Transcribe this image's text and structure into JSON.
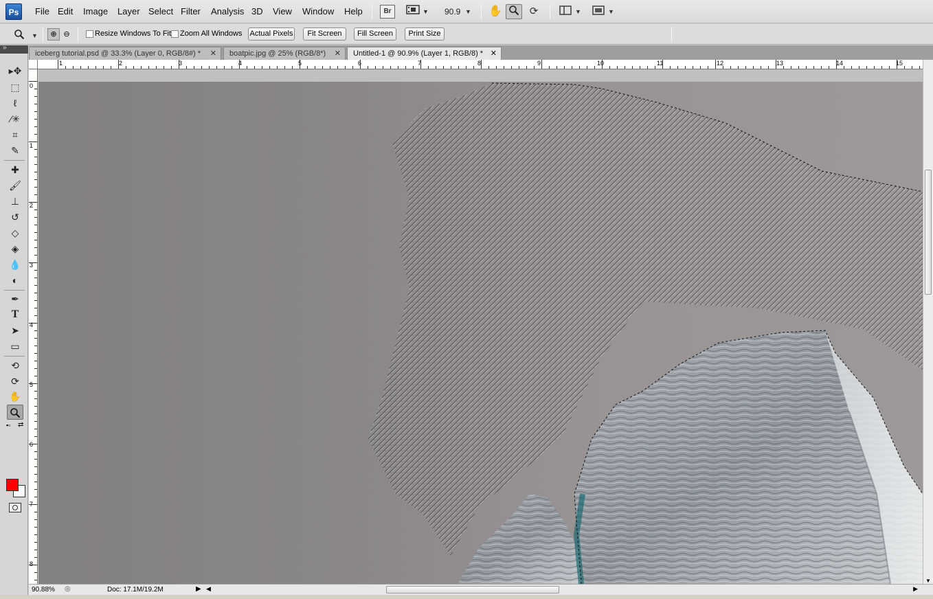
{
  "menubar": {
    "logo": "Ps",
    "menus": [
      "File",
      "Edit",
      "Image",
      "Layer",
      "Select",
      "Filter",
      "Analysis",
      "3D",
      "View",
      "Window",
      "Help"
    ],
    "bridge_label": "Br",
    "zoom_value": "90.9",
    "icons": [
      "bridge-icon",
      "film-icon",
      "hand-icon",
      "zoom-icon",
      "rotate-icon",
      "arrange-icon",
      "screen-mode-icon"
    ]
  },
  "options": {
    "resize_label": "Resize Windows To Fit",
    "zoom_all_label": "Zoom All Windows",
    "actual_pixels": "Actual Pixels",
    "fit_screen": "Fit Screen",
    "fill_screen": "Fill Screen",
    "print_size": "Print Size"
  },
  "tabs": [
    {
      "label": "iceberg tutorial.psd @ 33.3% (Layer 0, RGB/8#) *",
      "close": "✕"
    },
    {
      "label": "boatpic.jpg @ 25% (RGB/8*)",
      "close": "✕"
    },
    {
      "label": "Untitled-1 @ 90.9% (Layer 1, RGB/8) *",
      "close": "✕"
    }
  ],
  "ruler": {
    "top": [
      "1",
      "2",
      "3",
      "4",
      "5",
      "6",
      "7",
      "8",
      "9",
      "10",
      "11",
      "12",
      "13",
      "14",
      "15"
    ],
    "left": [
      "0",
      "1",
      "2",
      "3",
      "4",
      "5",
      "6",
      "7",
      "8"
    ]
  },
  "tools": [
    "move-tool",
    "marquee-tool",
    "lasso-tool",
    "magic-wand-tool",
    "crop-tool",
    "eyedropper-tool",
    "healing-brush-tool",
    "brush-tool",
    "clone-stamp-tool",
    "history-brush-tool",
    "eraser-tool",
    "paint-bucket-tool",
    "blur-tool",
    "dodge-tool",
    "pen-tool",
    "type-tool",
    "path-selection-tool",
    "rectangle-tool",
    "3d-rotate-tool",
    "3d-orbit-tool",
    "hand-tool",
    "zoom-tool",
    "quick-mask-tool"
  ],
  "colors": {
    "foreground": "#ff0000",
    "background": "#ffffff"
  },
  "status": {
    "zoom": "90.88%",
    "doc": "Doc: 17.1M/19.2M"
  }
}
